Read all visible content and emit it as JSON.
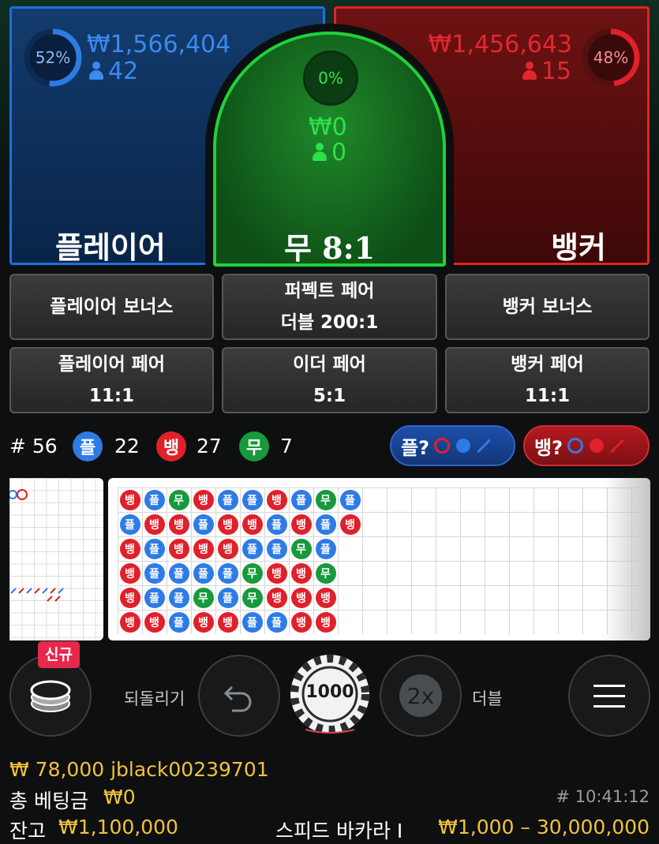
{
  "player": {
    "percent": "52%",
    "amount": "₩1,566,404",
    "count": "42",
    "label": "플레이어",
    "fill": 0.52
  },
  "banker": {
    "percent": "48%",
    "amount": "₩1,456,643",
    "count": "15",
    "label": "뱅커",
    "fill": 0.48
  },
  "tie": {
    "percent": "0%",
    "amount": "₩0",
    "count": "0",
    "label": "무 8:1"
  },
  "side_bets": [
    {
      "line1": "플레이어 보너스",
      "line2": ""
    },
    {
      "line1": "퍼펙트 페어",
      "line2": "더블 200:1"
    },
    {
      "line1": "뱅커 보너스",
      "line2": ""
    },
    {
      "line1": "플레이어 페어",
      "line2": "11:1"
    },
    {
      "line1": "이더 페어",
      "line2": "5:1"
    },
    {
      "line1": "뱅커 페어",
      "line2": "11:1"
    }
  ],
  "stats": {
    "round": "# 56",
    "player_glyph": "플",
    "player_count": "22",
    "banker_glyph": "뱅",
    "banker_count": "27",
    "tie_glyph": "무",
    "tie_count": "7"
  },
  "ask": {
    "player": "플?",
    "banker": "뱅?"
  },
  "bead_road": [
    [
      "뱅",
      "플",
      "뱅",
      "뱅",
      "뱅",
      "뱅"
    ],
    [
      "플",
      "뱅",
      "플",
      "플",
      "플",
      "뱅"
    ],
    [
      "무",
      "뱅",
      "뱅",
      "플",
      "플",
      "플"
    ],
    [
      "뱅",
      "플",
      "뱅",
      "플",
      "무",
      "뱅"
    ],
    [
      "플",
      "뱅",
      "뱅",
      "플",
      "플",
      "뱅"
    ],
    [
      "플",
      "뱅",
      "플",
      "무",
      "무",
      "플"
    ],
    [
      "뱅",
      "플",
      "플",
      "뱅",
      "뱅",
      "플"
    ],
    [
      "플",
      "뱅",
      "무",
      "뱅",
      "뱅",
      "뱅"
    ],
    [
      "무",
      "플",
      "플",
      "무",
      "뱅",
      "뱅"
    ],
    [
      "플",
      "뱅",
      "",
      "",
      "",
      ""
    ]
  ],
  "bead_legend": {
    "player": "플",
    "banker": "뱅",
    "tie": "무"
  },
  "controls": {
    "new_badge": "신규",
    "undo_label": "되돌리기",
    "chip_value": "1000",
    "double_icon": "2x",
    "double_label": "더블"
  },
  "footer": {
    "user": "₩ 78,000 jblack00239701",
    "total_bet_label": "총 베팅금",
    "total_bet_value": "₩0",
    "time": "# 10:41:12",
    "balance_label": "잔고",
    "balance_value": "₩1,100,000",
    "game_name": "스피드 바카라 I",
    "limits": "₩1,000 – 30,000,000"
  },
  "colors": {
    "player": "#2e7be6",
    "banker": "#e0202a",
    "tie": "#1fd13a",
    "gold": "#f2c23a"
  }
}
